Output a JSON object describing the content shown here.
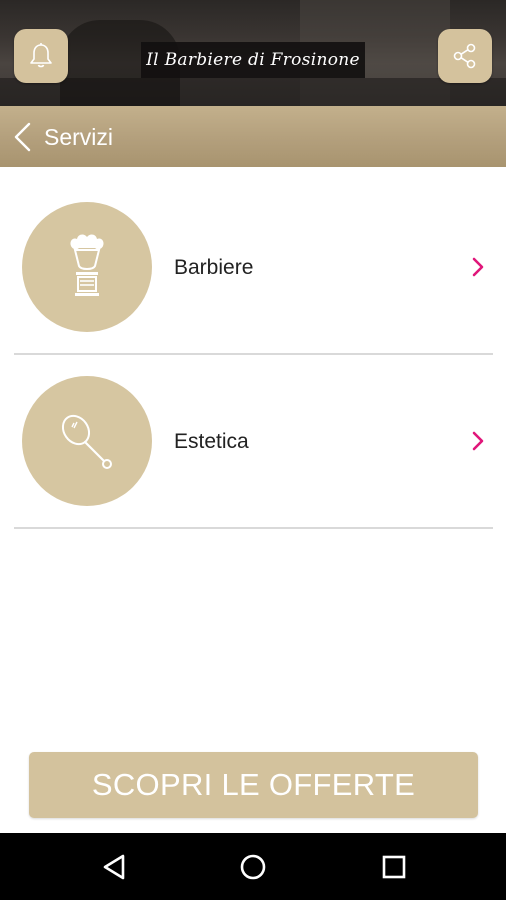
{
  "header": {
    "logo_text": "Il Barbiere di Frosinone",
    "left_icon": "bell-icon",
    "right_icon": "share-icon"
  },
  "titlebar": {
    "back_icon": "chevron-left-icon",
    "title": "Servizi"
  },
  "services": [
    {
      "label": "Barbiere",
      "icon": "shaving-brush-icon"
    },
    {
      "label": "Estetica",
      "icon": "hand-mirror-icon"
    }
  ],
  "cta": {
    "label": "SCOPRI LE OFFERTE"
  },
  "navbar": {
    "back_icon": "nav-back-icon",
    "home_icon": "nav-home-icon",
    "recent_icon": "nav-recent-apps-icon"
  },
  "colors": {
    "accent": "#d4c29d",
    "titlebar": "#b39f7c",
    "chevron": "#e0167a",
    "divider": "#d9d9d9"
  }
}
